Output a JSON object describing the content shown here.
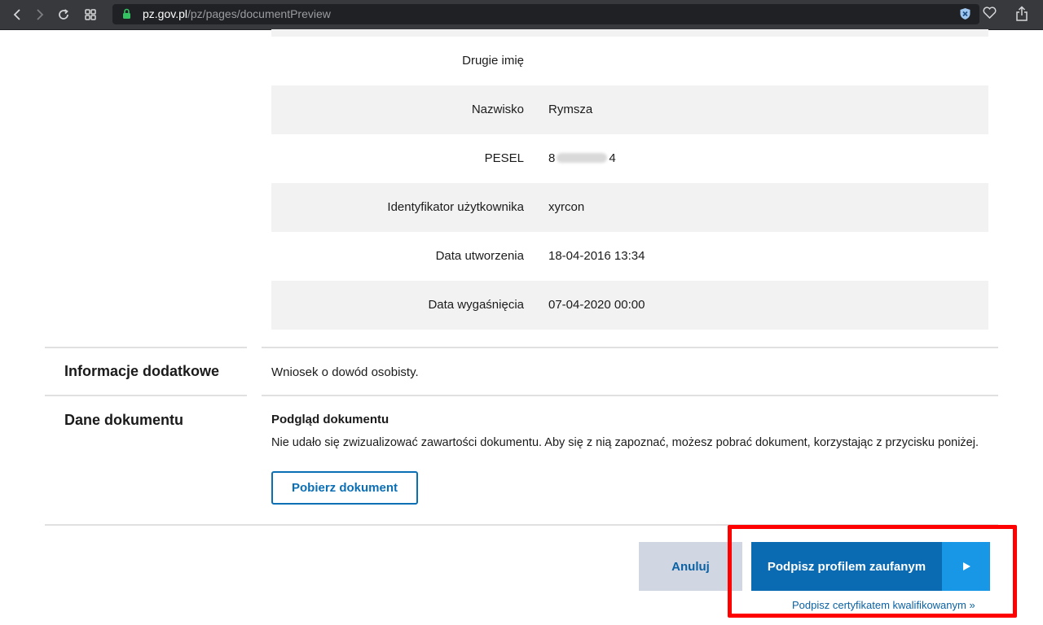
{
  "browser": {
    "url_host": "pz.gov.pl",
    "url_path": "/pz/pages/documentPreview",
    "icons": [
      "back-icon",
      "forward-icon",
      "reload-icon",
      "grid-icon",
      "lock-icon",
      "shield-icon",
      "heart-icon",
      "share-icon"
    ]
  },
  "details": {
    "rows": [
      {
        "label": "Drugie imię",
        "value": ""
      },
      {
        "label": "Nazwisko",
        "value": "Rymsza"
      },
      {
        "label": "PESEL",
        "value_start": "8",
        "value_end": "4"
      },
      {
        "label": "Identyfikator użytkownika",
        "value": "xyrcon"
      },
      {
        "label": "Data utworzenia",
        "value": "18-04-2016 13:34"
      },
      {
        "label": "Data wygaśnięcia",
        "value": "07-04-2020 00:00"
      }
    ]
  },
  "additional_info": {
    "title": "Informacje dodatkowe",
    "text": "Wniosek o dowód osobisty."
  },
  "document": {
    "title": "Dane dokumentu",
    "preview_title": "Podgląd dokumentu",
    "preview_text": "Nie udało się zwizualizować zawartości dokumentu. Aby się z nią zapoznać, możesz pobrać dokument, korzystając z przycisku poniżej.",
    "download_label": "Pobierz dokument"
  },
  "actions": {
    "cancel_label": "Anuluj",
    "sign_label": "Podpisz profilem zaufanym",
    "cert_link_label": "Podpisz certyfikatem kwalifikowanym »"
  },
  "colors": {
    "primary": "#0a6ab2",
    "primary_arrow": "#1797e6",
    "cancel_bg": "#d0d6e2",
    "highlight": "#ff0000"
  }
}
